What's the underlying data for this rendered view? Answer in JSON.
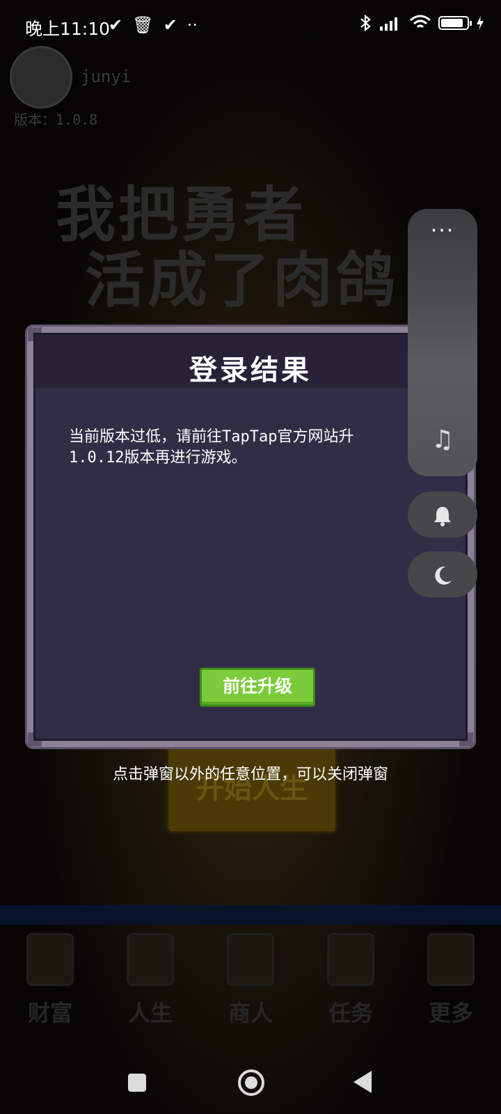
{
  "status_bar": {
    "time": "晚上11:10",
    "left_icons": [
      "✔",
      "🗑",
      "✔",
      "··"
    ],
    "battery_level": 0.85
  },
  "background": {
    "username": "junyi",
    "version": "版本：1.0.8",
    "title_line1": "我把勇者",
    "title_line2": "活成了肉鸽",
    "start_button": "开始人生",
    "nav_items": [
      "财富",
      "人生",
      "商人",
      "任务",
      "更多"
    ]
  },
  "dialog": {
    "title": "登录结果",
    "message": "当前版本过低，请前往TapTap官方网站升\n1.0.12版本再进行游戏。",
    "button_label": "前往升级",
    "close_hint": "点击弹窗以外的任意位置，可以关闭弹窗"
  },
  "side_panel": {
    "more_icon": "···",
    "music_icon": "♫",
    "bell_icon": "🔔",
    "moon_icon": "☾"
  },
  "colors": {
    "button_green": "#7acc3a",
    "dialog_bg": "#322d47",
    "frame": "#8d8197"
  }
}
